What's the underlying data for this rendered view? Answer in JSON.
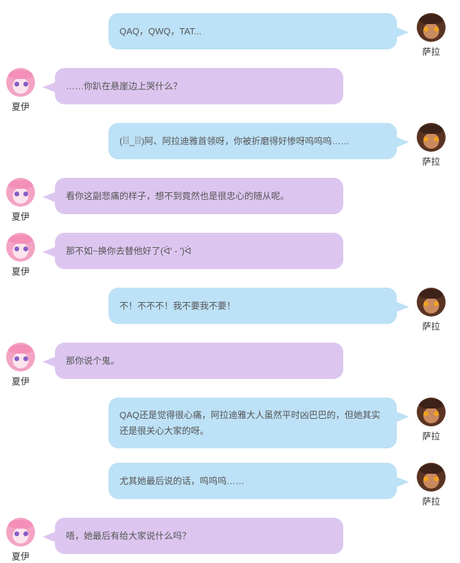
{
  "colors": {
    "sara_bubble": "#bde1f6",
    "xia_bubble": "#dcc6ef",
    "text": "#555555",
    "name": "#333333"
  },
  "characters": {
    "sara": {
      "name": "萨拉",
      "avatar_icon": "sara-avatar-icon"
    },
    "xia": {
      "name": "夏伊",
      "avatar_icon": "xia-avatar-icon"
    }
  },
  "messages": [
    {
      "speaker": "萨拉",
      "text": "QAQ，QWQ，TAT..."
    },
    {
      "speaker": "夏伊",
      "text": "……你趴在悬崖边上哭什么？"
    },
    {
      "speaker": "萨拉",
      "text": "(ꈨ_ꈨ)阿、阿拉迪雅首领呀，你被折磨得好惨呀呜呜呜……"
    },
    {
      "speaker": "夏伊",
      "text": "看你这副悲痛的样子，想不到竟然也是很忠心的随从呢。"
    },
    {
      "speaker": "夏伊",
      "text": "那不如~换你去替他好了(ᐛ' - ')ᐛ"
    },
    {
      "speaker": "萨拉",
      "text": "不！不不不！我不要我不要！"
    },
    {
      "speaker": "夏伊",
      "text": "那你说个鬼。"
    },
    {
      "speaker": "萨拉",
      "text": "QAQ还是觉得很心痛，阿拉迪雅大人虽然平时凶巴巴的，但她其实还是很关心大家的呀。"
    },
    {
      "speaker": "萨拉",
      "text": "尤其她最后说的话，呜呜呜……"
    },
    {
      "speaker": "夏伊",
      "text": "唔，她最后有给大家说什么吗？"
    }
  ]
}
